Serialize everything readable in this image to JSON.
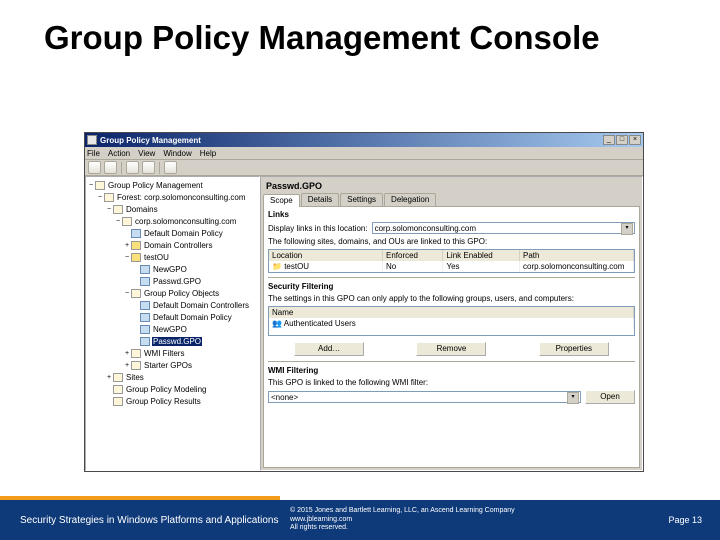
{
  "slide": {
    "title": "Group Policy Management Console"
  },
  "window": {
    "title": "Group Policy Management",
    "menus": [
      "File",
      "Action",
      "View",
      "Window",
      "Help"
    ]
  },
  "tree": {
    "root": "Group Policy Management",
    "forest": "Forest: corp.solomonconsulting.com",
    "items": [
      {
        "indent": 0,
        "twist": "−",
        "label": "Group Policy Management",
        "icon": "root"
      },
      {
        "indent": 1,
        "twist": "−",
        "label": "Forest: corp.solomonconsulting.com",
        "icon": "forest"
      },
      {
        "indent": 2,
        "twist": "−",
        "label": "Domains",
        "icon": "fold"
      },
      {
        "indent": 3,
        "twist": "−",
        "label": "corp.solomonconsulting.com",
        "icon": "dom"
      },
      {
        "indent": 4,
        "twist": "",
        "label": "Default Domain Policy",
        "icon": "gpo"
      },
      {
        "indent": 4,
        "twist": "+",
        "label": "Domain Controllers",
        "icon": "ou"
      },
      {
        "indent": 4,
        "twist": "−",
        "label": "testOU",
        "icon": "ou"
      },
      {
        "indent": 5,
        "twist": "",
        "label": "NewGPO",
        "icon": "gpo"
      },
      {
        "indent": 5,
        "twist": "",
        "label": "Passwd.GPO",
        "icon": "gpo"
      },
      {
        "indent": 4,
        "twist": "−",
        "label": "Group Policy Objects",
        "icon": "fold"
      },
      {
        "indent": 5,
        "twist": "",
        "label": "Default Domain Controllers",
        "icon": "gpo"
      },
      {
        "indent": 5,
        "twist": "",
        "label": "Default Domain Policy",
        "icon": "gpo"
      },
      {
        "indent": 5,
        "twist": "",
        "label": "NewGPO",
        "icon": "gpo"
      },
      {
        "indent": 5,
        "twist": "",
        "label": "Passwd.GPO",
        "icon": "gpo",
        "sel": true
      },
      {
        "indent": 4,
        "twist": "+",
        "label": "WMI Filters",
        "icon": "fold"
      },
      {
        "indent": 4,
        "twist": "+",
        "label": "Starter GPOs",
        "icon": "fold"
      },
      {
        "indent": 2,
        "twist": "+",
        "label": "Sites",
        "icon": "fold"
      },
      {
        "indent": 2,
        "twist": "",
        "label": "Group Policy Modeling",
        "icon": "rpt"
      },
      {
        "indent": 2,
        "twist": "",
        "label": "Group Policy Results",
        "icon": "rpt"
      }
    ]
  },
  "right": {
    "gpo_title": "Passwd.GPO",
    "tabs": [
      "Scope",
      "Details",
      "Settings",
      "Delegation"
    ],
    "active_tab": 0,
    "links_heading": "Links",
    "links_label": "Display links in this location:",
    "links_location": "corp.solomonconsulting.com",
    "links_desc": "The following sites, domains, and OUs are linked to this GPO:",
    "links_cols": [
      "Location",
      "Enforced",
      "Link Enabled",
      "Path"
    ],
    "links_row": {
      "loc": "testOU",
      "enf": "No",
      "le": "Yes",
      "path": "corp.solomonconsulting.com"
    },
    "sec_heading": "Security Filtering",
    "sec_desc": "The settings in this GPO can only apply to the following groups, users, and computers:",
    "sec_col": "Name",
    "sec_row": "Authenticated Users",
    "buttons": {
      "add": "Add…",
      "remove": "Remove",
      "props": "Properties"
    },
    "wmi_heading": "WMI Filtering",
    "wmi_desc": "This GPO is linked to the following WMI filter:",
    "wmi_value": "<none>",
    "wmi_open": "Open"
  },
  "footer": {
    "left": "Security Strategies in Windows Platforms and Applications",
    "copy1": "© 2015 Jones and Bartlett Learning, LLC, an Ascend Learning Company",
    "copy2": "www.jblearning.com",
    "copy3": "All rights reserved.",
    "page": "Page 13"
  }
}
